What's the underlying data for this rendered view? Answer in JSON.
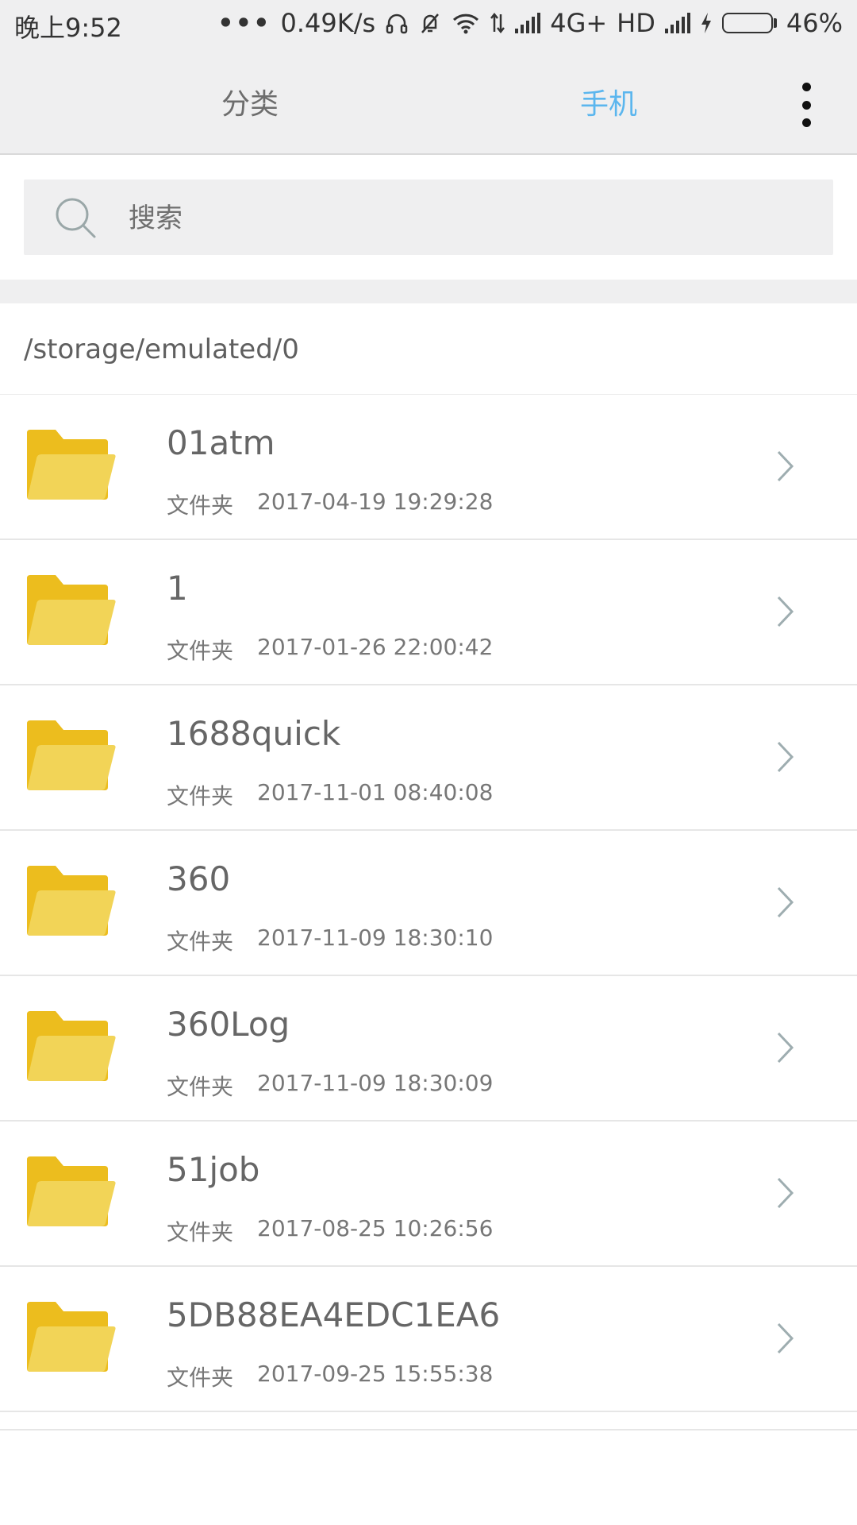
{
  "status_bar": {
    "time": "晚上9:52",
    "dots": "•••",
    "speed": "0.49K/s",
    "network": "4G+",
    "hd": "HD",
    "battery_percent": "46%",
    "battery_level": 0.46,
    "battery_color": "#4cc31a",
    "icons": [
      "headphones-icon",
      "bell-muted-icon",
      "wifi-icon",
      "data-arrows-icon",
      "signal-icon",
      "signal-icon",
      "charging-bolt-icon",
      "battery-icon"
    ]
  },
  "tabs": [
    {
      "label": "分类",
      "active": false
    },
    {
      "label": "手机",
      "active": true
    }
  ],
  "accent_color": "#5bb6ee",
  "search": {
    "placeholder": "搜索",
    "icon": "search-icon"
  },
  "path": "/storage/emulated/0",
  "files": [
    {
      "name": "01atm",
      "type": "文件夹",
      "date": "2017-04-19 19:29:28"
    },
    {
      "name": "1",
      "type": "文件夹",
      "date": "2017-01-26 22:00:42"
    },
    {
      "name": "1688quick",
      "type": "文件夹",
      "date": "2017-11-01 08:40:08"
    },
    {
      "name": "360",
      "type": "文件夹",
      "date": "2017-11-09 18:30:10"
    },
    {
      "name": "360Log",
      "type": "文件夹",
      "date": "2017-11-09 18:30:09"
    },
    {
      "name": "51job",
      "type": "文件夹",
      "date": "2017-08-25 10:26:56"
    },
    {
      "name": "5DB88EA4EDC1EA6",
      "type": "文件夹",
      "date": "2017-09-25 15:55:38"
    }
  ],
  "folder_color": "#f2ce3a"
}
